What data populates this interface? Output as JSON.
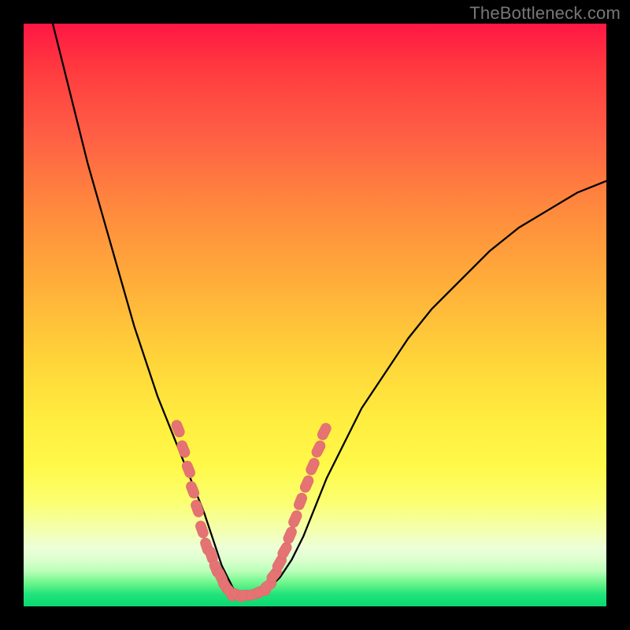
{
  "watermark": "TheBottleneck.com",
  "colors": {
    "frame": "#000000",
    "curve": "#000000",
    "marker": "#e57373"
  },
  "chart_data": {
    "type": "line",
    "title": "",
    "xlabel": "",
    "ylabel": "",
    "xlim": [
      0,
      100
    ],
    "ylim": [
      0,
      100
    ],
    "legend": false,
    "grid": false,
    "note": "Unlabeled V-shaped bottleneck curve over a vertical hue gradient (red→green). Values estimated from pixel positions; x,y normalized to 0–100 with origin at bottom-left of the colored plot area.",
    "series": [
      {
        "name": "bottleneck-curve",
        "x": [
          5,
          7,
          9,
          11,
          13,
          15,
          17,
          19,
          21,
          23,
          25,
          27,
          29,
          31,
          33,
          34,
          35,
          36,
          37,
          38,
          40,
          42,
          44,
          46,
          48,
          50,
          52,
          55,
          58,
          62,
          66,
          70,
          75,
          80,
          85,
          90,
          95,
          100
        ],
        "y": [
          100,
          92,
          84,
          76,
          69,
          62,
          55,
          48,
          42,
          36,
          31,
          26,
          21,
          16,
          10,
          7,
          5,
          3,
          2,
          2,
          2,
          3,
          5,
          8,
          12,
          17,
          22,
          28,
          34,
          40,
          46,
          51,
          56,
          61,
          65,
          68,
          71,
          73
        ]
      }
    ],
    "markers": {
      "comment": "Pink lozenge markers clustered low on both arms of the V; x,y normalized 0–100.",
      "points": [
        {
          "x": 26.5,
          "y": 30.5
        },
        {
          "x": 27.4,
          "y": 27.0
        },
        {
          "x": 28.3,
          "y": 23.5
        },
        {
          "x": 29.0,
          "y": 20.0
        },
        {
          "x": 29.8,
          "y": 16.8
        },
        {
          "x": 30.6,
          "y": 13.2
        },
        {
          "x": 31.4,
          "y": 10.3
        },
        {
          "x": 32.2,
          "y": 8.8
        },
        {
          "x": 33.0,
          "y": 6.5
        },
        {
          "x": 33.8,
          "y": 5.2
        },
        {
          "x": 34.6,
          "y": 3.5
        },
        {
          "x": 35.5,
          "y": 2.3
        },
        {
          "x": 36.8,
          "y": 1.9
        },
        {
          "x": 38.2,
          "y": 1.9
        },
        {
          "x": 39.6,
          "y": 2.1
        },
        {
          "x": 40.9,
          "y": 2.6
        },
        {
          "x": 42.0,
          "y": 3.6
        },
        {
          "x": 43.0,
          "y": 5.4
        },
        {
          "x": 43.9,
          "y": 7.4
        },
        {
          "x": 44.8,
          "y": 9.6
        },
        {
          "x": 45.7,
          "y": 12.2
        },
        {
          "x": 46.6,
          "y": 15.0
        },
        {
          "x": 47.5,
          "y": 18.0
        },
        {
          "x": 48.6,
          "y": 21.0
        },
        {
          "x": 49.6,
          "y": 24.0
        },
        {
          "x": 50.6,
          "y": 27.0
        },
        {
          "x": 51.6,
          "y": 30.0
        }
      ]
    }
  }
}
